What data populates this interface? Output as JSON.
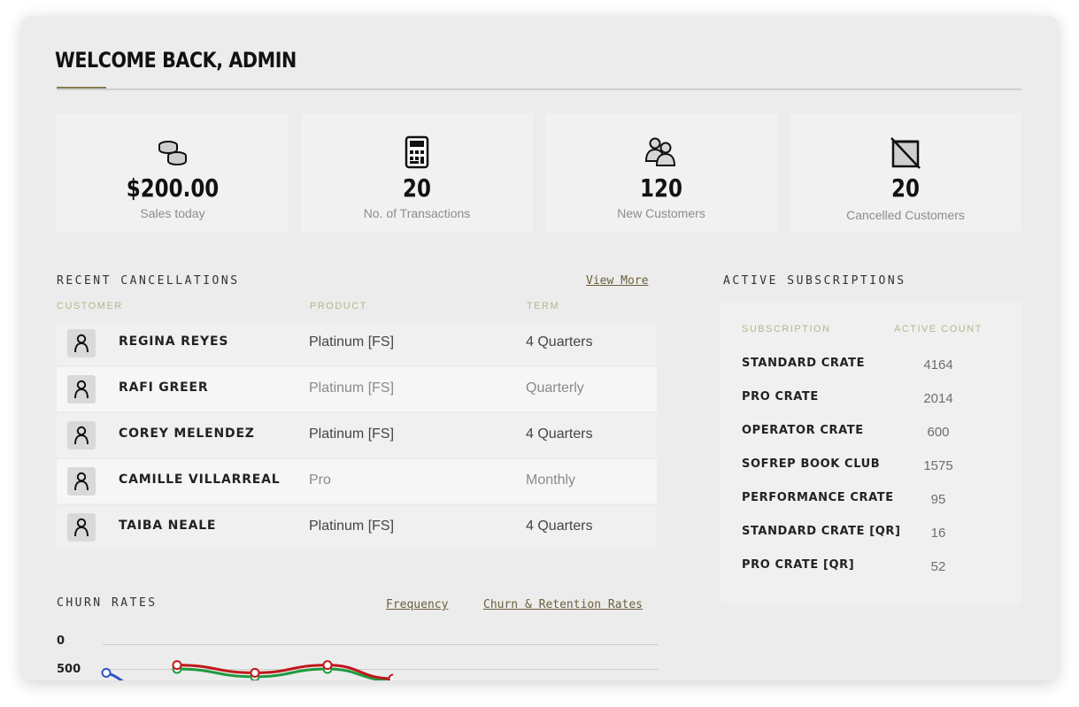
{
  "header": {
    "title": "WELCOME BACK, ADMIN"
  },
  "stats": [
    {
      "icon": "coins-icon",
      "value": "$200.00",
      "label": "Sales today"
    },
    {
      "icon": "calculator-icon",
      "value": "20",
      "label": "No. of Transactions"
    },
    {
      "icon": "users-icon",
      "value": "120",
      "label": "New Customers"
    },
    {
      "icon": "cancelled-box-icon",
      "value": "20",
      "label": "Cancelled Customers"
    }
  ],
  "recent_cancellations": {
    "heading": "RECENT CANCELLATIONS",
    "view_more": "View More",
    "columns": {
      "customer": "CUSTOMER",
      "product": "PRODUCT",
      "term": "TERM"
    },
    "rows": [
      {
        "name": "REGINA REYES",
        "product": "Platinum [FS]",
        "term": "4 Quarters"
      },
      {
        "name": "RAFI GREER",
        "product": "Platinum [FS]",
        "term": "Quarterly"
      },
      {
        "name": "COREY MELENDEZ",
        "product": "Platinum [FS]",
        "term": "4 Quarters"
      },
      {
        "name": "CAMILLE VILLARREAL",
        "product": "Pro",
        "term": "Monthly"
      },
      {
        "name": "TAIBA NEALE",
        "product": "Platinum [FS]",
        "term": "4 Quarters"
      }
    ]
  },
  "active_subscriptions": {
    "heading": "ACTIVE SUBSCRIPTIONS",
    "columns": {
      "subscription": "SUBSCRIPTION",
      "active_count": "ACTIVE COUNT"
    },
    "rows": [
      {
        "name": "STANDARD CRATE",
        "count": "4164"
      },
      {
        "name": "PRO CRATE",
        "count": "2014"
      },
      {
        "name": "OPERATOR CRATE",
        "count": "600"
      },
      {
        "name": "SOFREP BOOK CLUB",
        "count": "1575"
      },
      {
        "name": "PERFORMANCE CRATE",
        "count": "95"
      },
      {
        "name": "STANDARD CRATE [QR]",
        "count": "16"
      },
      {
        "name": "PRO CRATE [QR]",
        "count": "52"
      }
    ]
  },
  "churn": {
    "heading": "CHURN RATES",
    "tabs": [
      "Frequency",
      "Churn & Retention Rates"
    ],
    "colors": {
      "green": "#1e9a3e",
      "red": "#c0171b",
      "blue": "#2f54c8"
    }
  },
  "chart_data": {
    "type": "line",
    "yticks": [
      "0",
      "500"
    ],
    "series": [
      {
        "color": "green",
        "values": [
          null,
          520,
          480,
          520,
          460
        ]
      },
      {
        "color": "red",
        "values": [
          null,
          540,
          500,
          540,
          470
        ]
      },
      {
        "color": "blue",
        "values": [
          500,
          null,
          null,
          null,
          null
        ]
      }
    ]
  }
}
